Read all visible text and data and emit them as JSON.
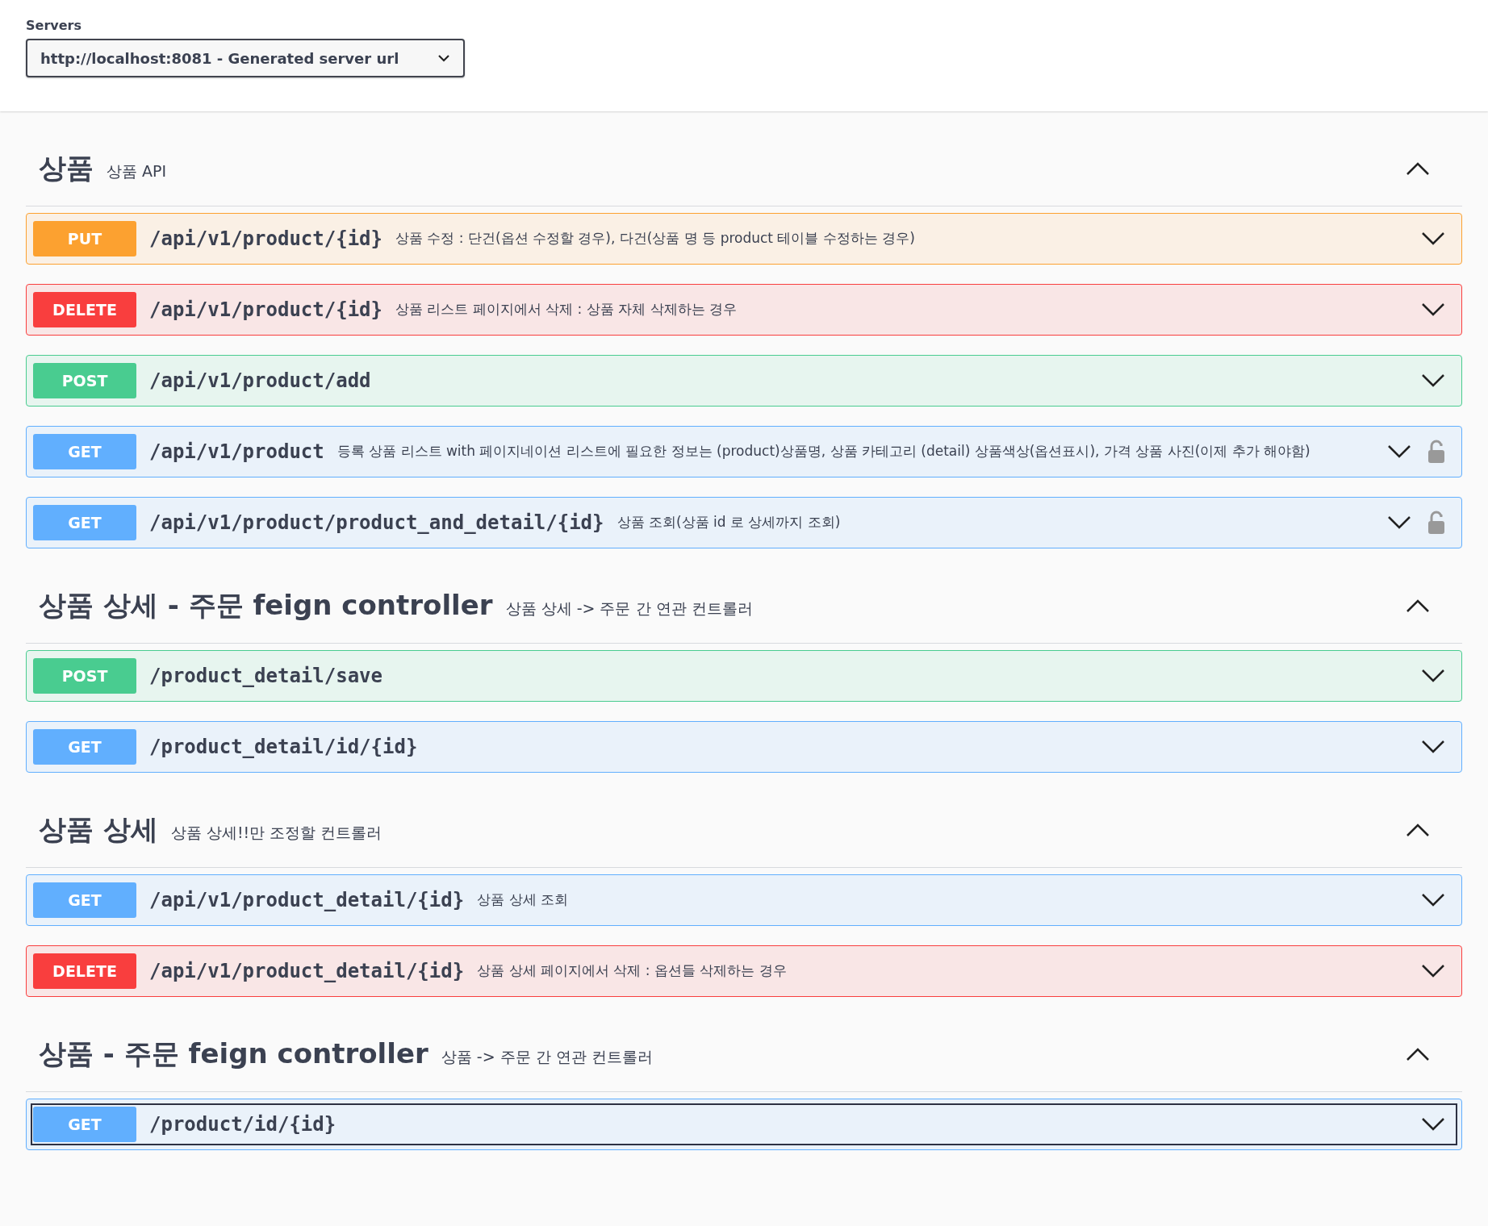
{
  "servers": {
    "label": "Servers",
    "value": "http://localhost:8081 - Generated server url"
  },
  "sections": [
    {
      "title": "상품",
      "description": "상품 API",
      "expanded": true,
      "operations": [
        {
          "method": "PUT",
          "path": "/api/v1/product/{id}",
          "summary": "상품 수정 : 단건(옵션 수정할 경우), 다건(상품 명 등 product 테이블 수정하는 경우)",
          "locked": false,
          "focused": false
        },
        {
          "method": "DELETE",
          "path": "/api/v1/product/{id}",
          "summary": "상품 리스트 페이지에서 삭제 : 상품 자체 삭제하는 경우",
          "locked": false,
          "focused": false
        },
        {
          "method": "POST",
          "path": "/api/v1/product/add",
          "locked": false,
          "focused": false
        },
        {
          "method": "GET",
          "path": "/api/v1/product",
          "summary": "등록 상품 리스트 with 페이지네이션 리스트에 필요한 정보는 (product)상품명, 상품 카테고리 (detail) 상품색상(옵션표시), 가격 상품 사진(이제 추가 해야함)",
          "locked": true,
          "focused": false
        },
        {
          "method": "GET",
          "path": "/api/v1/product/product_and_detail/{id}",
          "summary": "상품 조회(상품 id 로 상세까지 조회)",
          "locked": true,
          "focused": false
        }
      ]
    },
    {
      "title": "상품 상세 - 주문 feign controller",
      "description": "상품 상세 -> 주문 간 연관 컨트롤러",
      "expanded": true,
      "operations": [
        {
          "method": "POST",
          "path": "/product_detail/save",
          "locked": false,
          "focused": false
        },
        {
          "method": "GET",
          "path": "/product_detail/id/{id}",
          "locked": false,
          "focused": false
        }
      ]
    },
    {
      "title": "상품 상세",
      "description": "상품 상세!!만 조정할 컨트롤러",
      "expanded": true,
      "operations": [
        {
          "method": "GET",
          "path": "/api/v1/product_detail/{id}",
          "summary": "상품 상세 조회",
          "locked": false,
          "focused": false
        },
        {
          "method": "DELETE",
          "path": "/api/v1/product_detail/{id}",
          "summary": "상품 상세 페이지에서 삭제 : 옵션들 삭제하는 경우",
          "locked": false,
          "focused": false
        }
      ]
    },
    {
      "title": "상품 - 주문 feign controller",
      "description": "상품 -> 주문 간 연관 컨트롤러",
      "expanded": true,
      "operations": [
        {
          "method": "GET",
          "path": "/product/id/{id}",
          "locked": false,
          "focused": true
        }
      ]
    }
  ]
}
